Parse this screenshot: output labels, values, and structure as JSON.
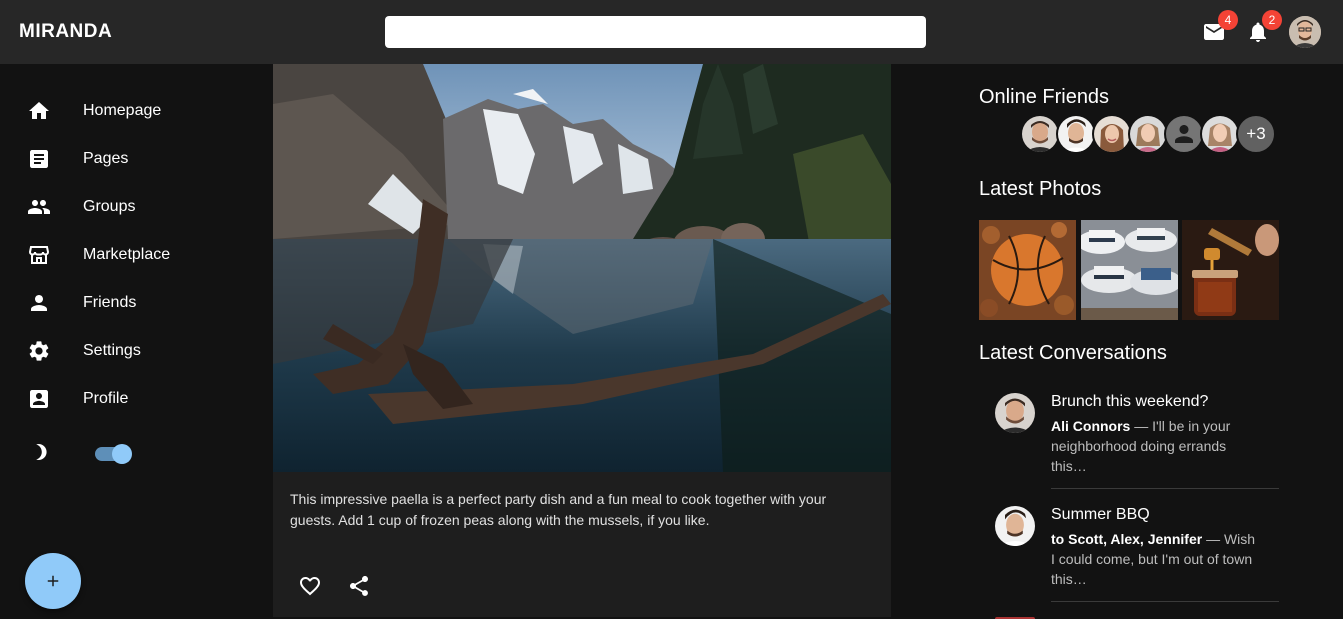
{
  "app": {
    "title": "MIRANDA"
  },
  "search": {
    "value": "",
    "placeholder": ""
  },
  "header": {
    "mail": {
      "icon": "mail-icon",
      "count": "4"
    },
    "notifications": {
      "icon": "bell-icon",
      "count": "2"
    },
    "avatar": "user-avatar"
  },
  "sidebar": {
    "items": [
      {
        "label": "Homepage",
        "icon": "home-icon"
      },
      {
        "label": "Pages",
        "icon": "article-icon"
      },
      {
        "label": "Groups",
        "icon": "groups-icon"
      },
      {
        "label": "Marketplace",
        "icon": "storefront-icon"
      },
      {
        "label": "Friends",
        "icon": "person-icon"
      },
      {
        "label": "Settings",
        "icon": "gear-icon"
      },
      {
        "label": "Profile",
        "icon": "account-box-icon"
      }
    ],
    "theme_toggle": {
      "icon": "moon-icon",
      "on": true
    },
    "fab": {
      "icon": "plus-icon"
    }
  },
  "post": {
    "image": "mountain-lake-photo",
    "caption": "This impressive paella is a perfect party dish and a fun meal to cook together with your guests. Add 1 cup of frozen peas along with the mussels, if you like.",
    "actions": [
      "heart-icon",
      "share-icon"
    ]
  },
  "online_friends": {
    "title": "Online Friends",
    "more": "+3"
  },
  "latest_photos": {
    "title": "Latest Photos",
    "photos": [
      "basketball-photo",
      "hats-photo",
      "honey-jar-photo"
    ]
  },
  "latest_conversations": {
    "title": "Latest Conversations",
    "items": [
      {
        "title": "Brunch this weekend?",
        "from": "Ali Connors",
        "snippet": " — I'll be in your neighborhood doing errands this…"
      },
      {
        "title": "Summer BBQ",
        "from": "to Scott, Alex, Jennifer",
        "snippet": " — Wish I could come, but I'm out of town this…"
      }
    ]
  },
  "colors": {
    "appbar": "#272727",
    "background": "#121212",
    "card": "#1e1e1e",
    "accent": "#90caf9",
    "badge": "#f44336"
  }
}
